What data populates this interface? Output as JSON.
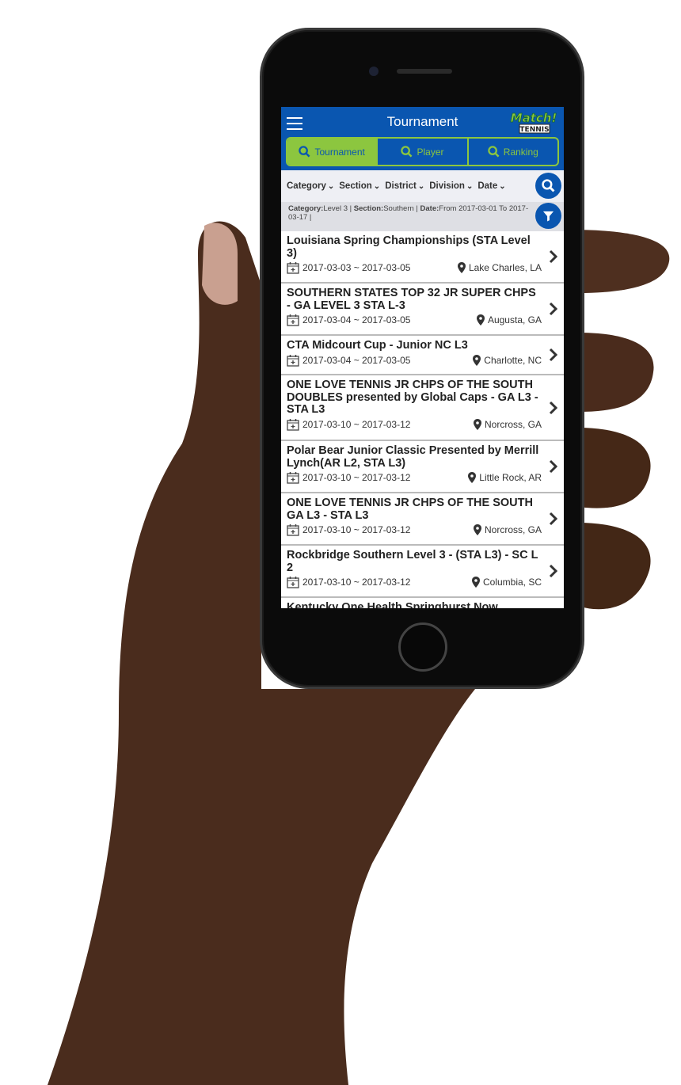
{
  "header": {
    "title": "Tournament",
    "logo_text": "Match! TENNIS",
    "accent": "#0a56b0",
    "green": "#8cc63f"
  },
  "tabs": [
    {
      "label": "Tournament",
      "active": true
    },
    {
      "label": "Player"
    },
    {
      "label": "Ranking"
    }
  ],
  "filters": [
    "Category",
    "Section",
    "District",
    "Division",
    "Date"
  ],
  "summary": {
    "l1": "Category:",
    "v1": "Level 3 | ",
    "l2": "Section:",
    "v2": "Southern | ",
    "l3": "Date:",
    "v3": "From 2017-03-01 To 2017-03-17 |"
  },
  "tournaments": [
    {
      "name": "Louisiana Spring Championships (STA Level 3)",
      "dates": "2017-03-03 ~ 2017-03-05",
      "location": "Lake Charles, LA"
    },
    {
      "name": "SOUTHERN STATES TOP 32 JR SUPER CHPS - GA LEVEL 3 STA L-3",
      "dates": "2017-03-04 ~ 2017-03-05",
      "location": "Augusta, GA"
    },
    {
      "name": "CTA Midcourt Cup - Junior NC L3",
      "dates": "2017-03-04 ~ 2017-03-05",
      "location": "Charlotte, NC"
    },
    {
      "name": "ONE LOVE TENNIS JR CHPS OF THE SOUTH DOUBLES presented by Global Caps - GA L3 - STA L3",
      "dates": "2017-03-10 ~ 2017-03-12",
      "location": "Norcross, GA"
    },
    {
      "name": "Polar Bear Junior Classic Presented by Merrill Lynch(AR L2, STA L3)",
      "dates": "2017-03-10 ~ 2017-03-12",
      "location": "Little Rock, AR"
    },
    {
      "name": "ONE LOVE TENNIS JR CHPS OF THE SOUTH GA L3 - STA L3",
      "dates": "2017-03-10 ~ 2017-03-12",
      "location": "Norcross, GA"
    },
    {
      "name": "Rockbridge Southern Level 3 - (STA L3) - SC L 2",
      "dates": "2017-03-10 ~ 2017-03-12",
      "location": "Columbia, SC"
    },
    {
      "name": "Kentucky One Health Springhurst Now"
    }
  ]
}
